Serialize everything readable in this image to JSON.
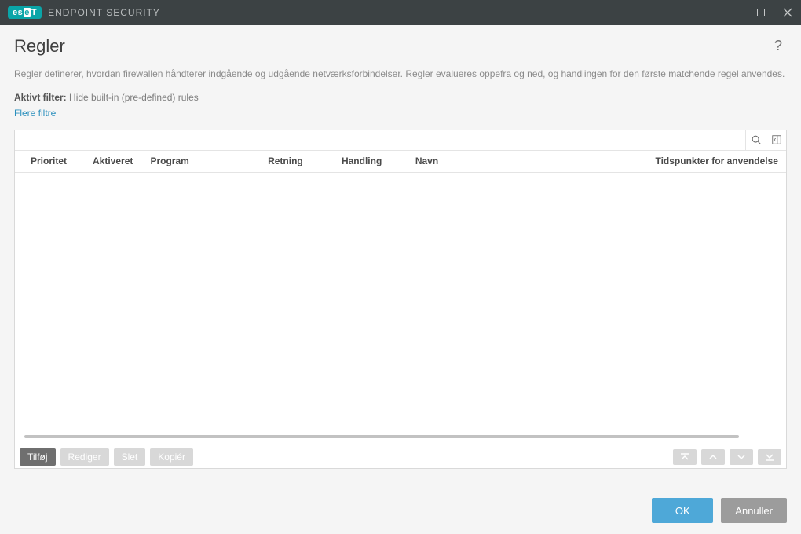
{
  "titlebar": {
    "brand_es": "es",
    "brand_e": "e",
    "brand_t": "T",
    "product": "ENDPOINT SECURITY"
  },
  "page": {
    "title": "Regler",
    "description": "Regler definerer, hvordan firewallen håndterer indgående og udgående netværksforbindelser. Regler evalueres oppefra og ned, og handlingen for den første matchende regel anvendes.",
    "filter_label": "Aktivt filter:",
    "filter_value": "Hide built-in (pre-defined) rules",
    "more_filters": "Flere filtre"
  },
  "columns": {
    "priority": "Prioritet",
    "enabled": "Aktiveret",
    "program": "Program",
    "direction": "Retning",
    "action": "Handling",
    "name": "Navn",
    "time": "Tidspunkter for anvendelse"
  },
  "toolbar": {
    "add": "Tilføj",
    "edit": "Rediger",
    "delete": "Slet",
    "copy": "Kopiér"
  },
  "dialog": {
    "ok": "OK",
    "cancel": "Annuller"
  }
}
